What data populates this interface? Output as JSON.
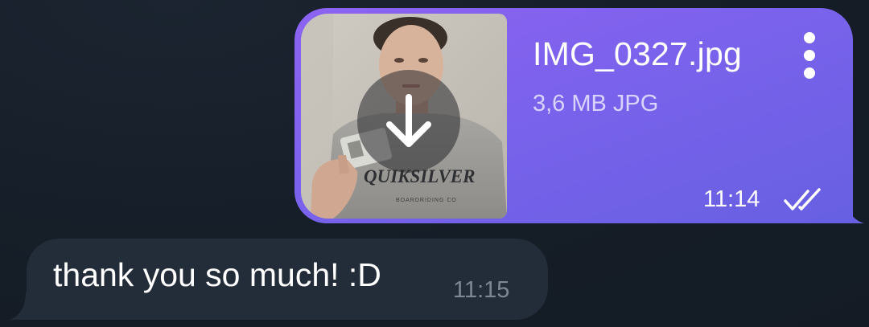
{
  "colors": {
    "background": "#161e28",
    "outgoing_bubble": "#7a62ec",
    "incoming_bubble": "#232d3a",
    "incoming_time": "#7d8896"
  },
  "messages": [
    {
      "direction": "outgoing",
      "type": "file",
      "file_name": "IMG_0327.jpg",
      "file_meta": "3,6 MB JPG",
      "time": "11:14",
      "status": "read",
      "status_icon": "double-check-icon",
      "thumbnail_text": "QUIKSILVER",
      "thumbnail_subtext": "BOARDRIDING CO",
      "download_icon": "download-arrow-icon",
      "menu_icon": "more-vertical-icon"
    },
    {
      "direction": "incoming",
      "type": "text",
      "text": "thank you so much! :D",
      "time": "11:15"
    }
  ]
}
